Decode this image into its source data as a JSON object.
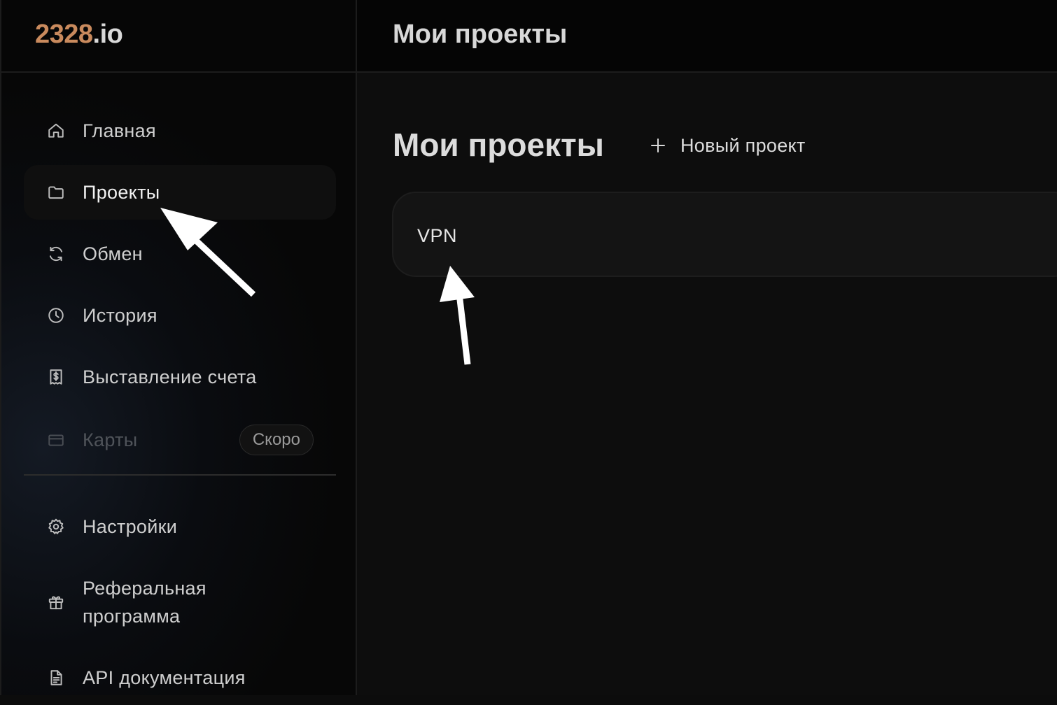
{
  "logo": {
    "number": "2328",
    "tld": ".io"
  },
  "header": {
    "title": "Мои проекты"
  },
  "sidebar": {
    "items": [
      {
        "label": "Главная",
        "icon": "home-icon"
      },
      {
        "label": "Проекты",
        "icon": "folder-icon",
        "active": true
      },
      {
        "label": "Обмен",
        "icon": "refresh-icon"
      },
      {
        "label": "История",
        "icon": "clock-icon"
      },
      {
        "label": "Выставление счета",
        "icon": "receipt-icon"
      },
      {
        "label": "Карты",
        "icon": "card-icon",
        "disabled": true,
        "badge": "Скоро"
      },
      {
        "label": "Настройки",
        "icon": "gear-icon"
      },
      {
        "label_line1": "Реферальная",
        "label_line2": "программа",
        "icon": "gift-icon"
      },
      {
        "label": "API документация",
        "icon": "document-icon"
      }
    ]
  },
  "main": {
    "title": "Мои проекты",
    "new_project_label": "Новый проект",
    "projects": [
      {
        "name": "VPN"
      }
    ]
  },
  "colors": {
    "logo_accent": "#c98a5d",
    "background": "#0c0c0c",
    "card": "#141414"
  }
}
